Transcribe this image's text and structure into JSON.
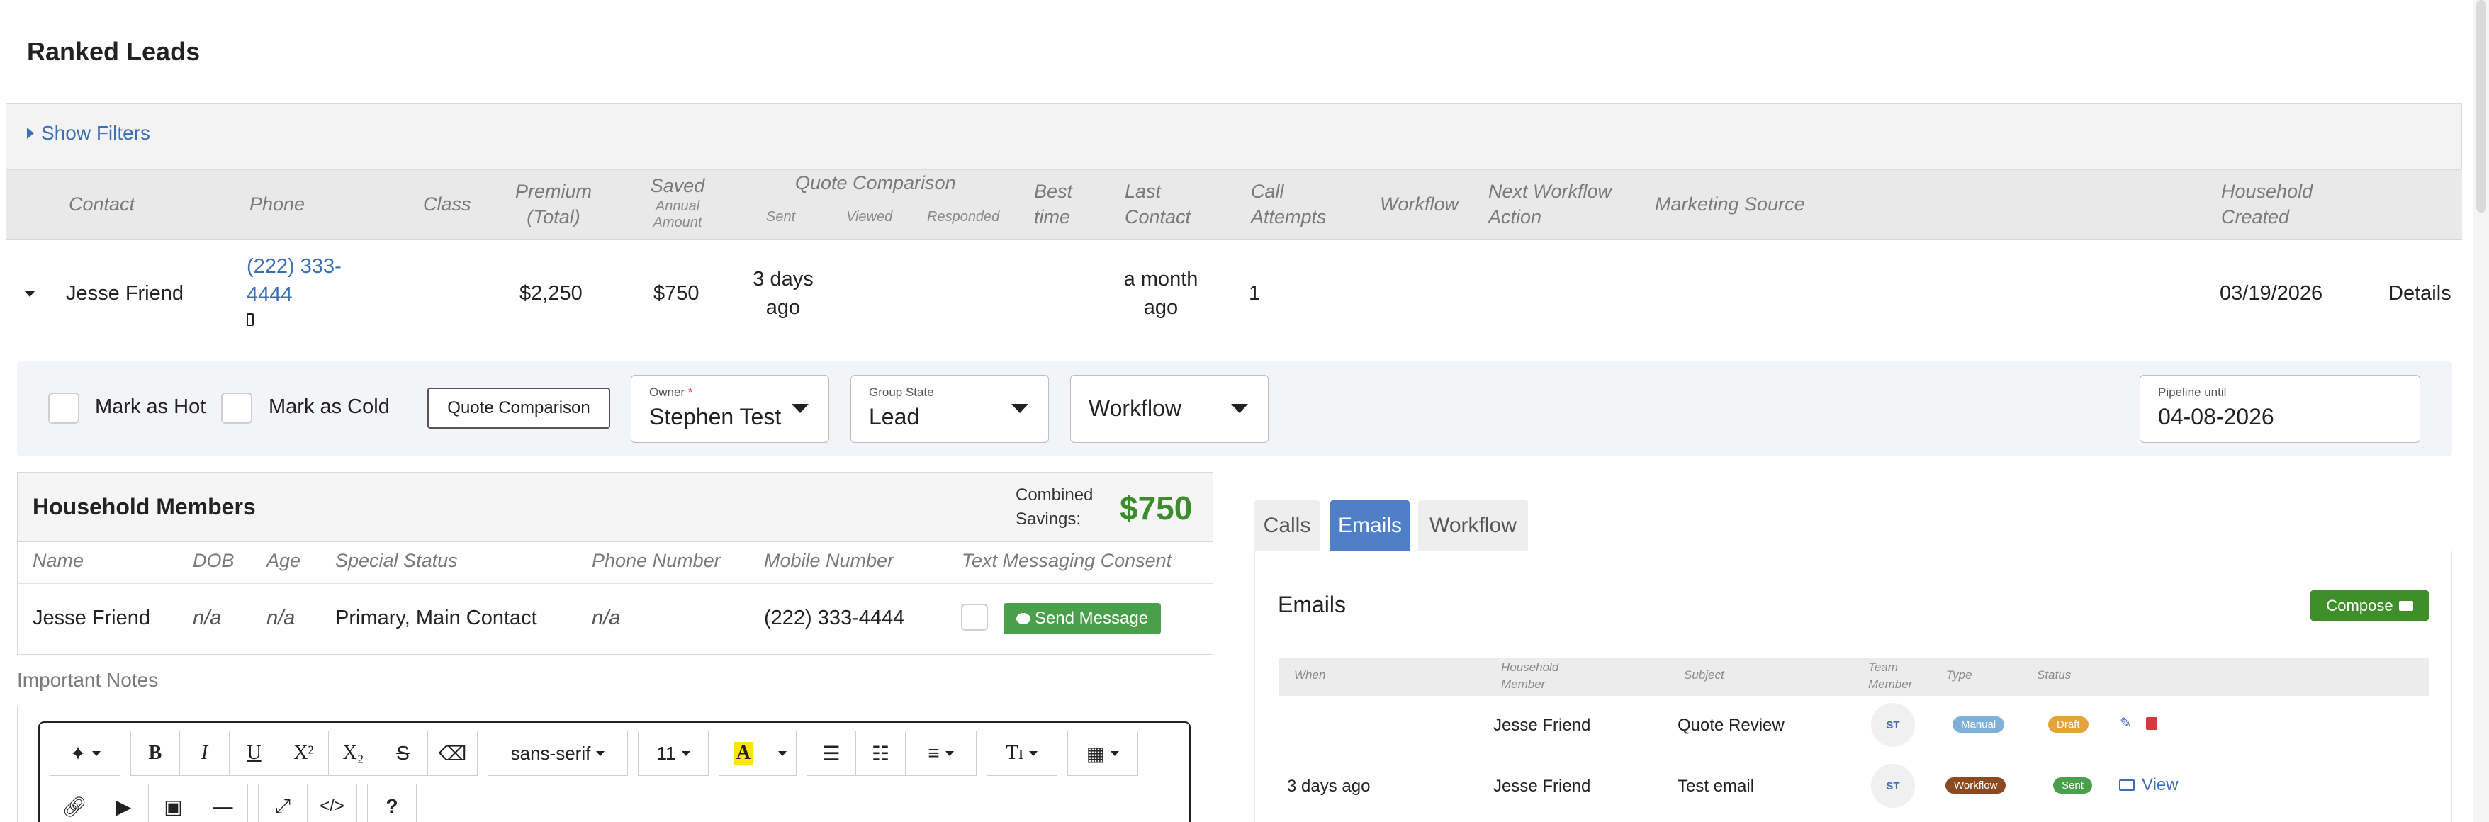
{
  "page": {
    "title": "Ranked Leads",
    "show_filters": "Show Filters"
  },
  "table": {
    "headers": {
      "contact": "Contact",
      "phone": "Phone",
      "class": "Class",
      "premium_1": "Premium",
      "premium_2": "(Total)",
      "saved_1": "Saved",
      "saved_2": "Annual",
      "saved_3": "Amount",
      "quote_comparison": "Quote Comparison",
      "sent": "Sent",
      "viewed": "Viewed",
      "responded": "Responded",
      "best_time_1": "Best",
      "best_time_2": "time",
      "last_contact_1": "Last",
      "last_contact_2": "Contact",
      "call_attempts_1": "Call",
      "call_attempts_2": "Attempts",
      "workflow": "Workflow",
      "next_action_1": "Next Workflow",
      "next_action_2": "Action",
      "marketing_source": "Marketing Source",
      "household_created_1": "Household",
      "household_created_2": "Created"
    },
    "row": {
      "contact": "Jesse Friend",
      "phone_1": "(222) 333-",
      "phone_2": "4444",
      "premium": "$2,250",
      "saved": "$750",
      "sent_1": "3 days",
      "sent_2": "ago",
      "last_contact_1": "a month",
      "last_contact_2": "ago",
      "call_attempts": "1",
      "household_created": "03/19/2026",
      "details": "Details"
    }
  },
  "actions": {
    "mark_hot": "Mark as Hot",
    "mark_cold": "Mark as Cold",
    "quote_comparison": "Quote Comparison",
    "owner_label": "Owner",
    "owner_required": "*",
    "owner_value": "Stephen Test",
    "group_state_label": "Group State",
    "group_state_value": "Lead",
    "workflow_value": "Workflow",
    "pipeline_label": "Pipeline until",
    "pipeline_value": "04-08-2026"
  },
  "household": {
    "title": "Household Members",
    "combined_1": "Combined",
    "combined_2": "Savings:",
    "combined_value": "$750",
    "columns": [
      "Name",
      "DOB",
      "Age",
      "Special Status",
      "Phone Number",
      "Mobile Number",
      "Text Messaging Consent"
    ],
    "member": {
      "name": "Jesse Friend",
      "dob": "n/a",
      "age": "n/a",
      "special_status": "Primary, Main Contact",
      "phone": "n/a",
      "mobile": "(222) 333-4444",
      "send_message": "Send Message"
    }
  },
  "notes": {
    "label": "Important Notes",
    "font_family": "sans-serif",
    "font_size": "11"
  },
  "tabs": {
    "calls": "Calls",
    "emails": "Emails",
    "workflow": "Workflow"
  },
  "emails": {
    "title": "Emails",
    "compose": "Compose",
    "columns": {
      "when": "When",
      "household_member_1": "Household",
      "household_member_2": "Member",
      "subject": "Subject",
      "team_member_1": "Team",
      "team_member_2": "Member",
      "type": "Type",
      "status": "Status"
    },
    "rows": [
      {
        "when": "",
        "member": "Jesse Friend",
        "subject": "Quote Review",
        "team": "ST",
        "type": "Manual",
        "status": "Draft"
      },
      {
        "when": "3 days ago",
        "member": "Jesse Friend",
        "subject": "Test email",
        "team": "ST",
        "type": "Workflow",
        "status": "Sent",
        "view": "View"
      }
    ]
  },
  "colors": {
    "link_blue": "#3b6fb6",
    "money_green": "#3c8b2c",
    "tab_active": "#4f7fc6",
    "compose_green": "#3e8e2a",
    "badge_manual": "#7fb0d8",
    "badge_draft": "#e3a33a",
    "badge_workflow": "#8b4a1f",
    "badge_sent": "#4aa04a"
  }
}
